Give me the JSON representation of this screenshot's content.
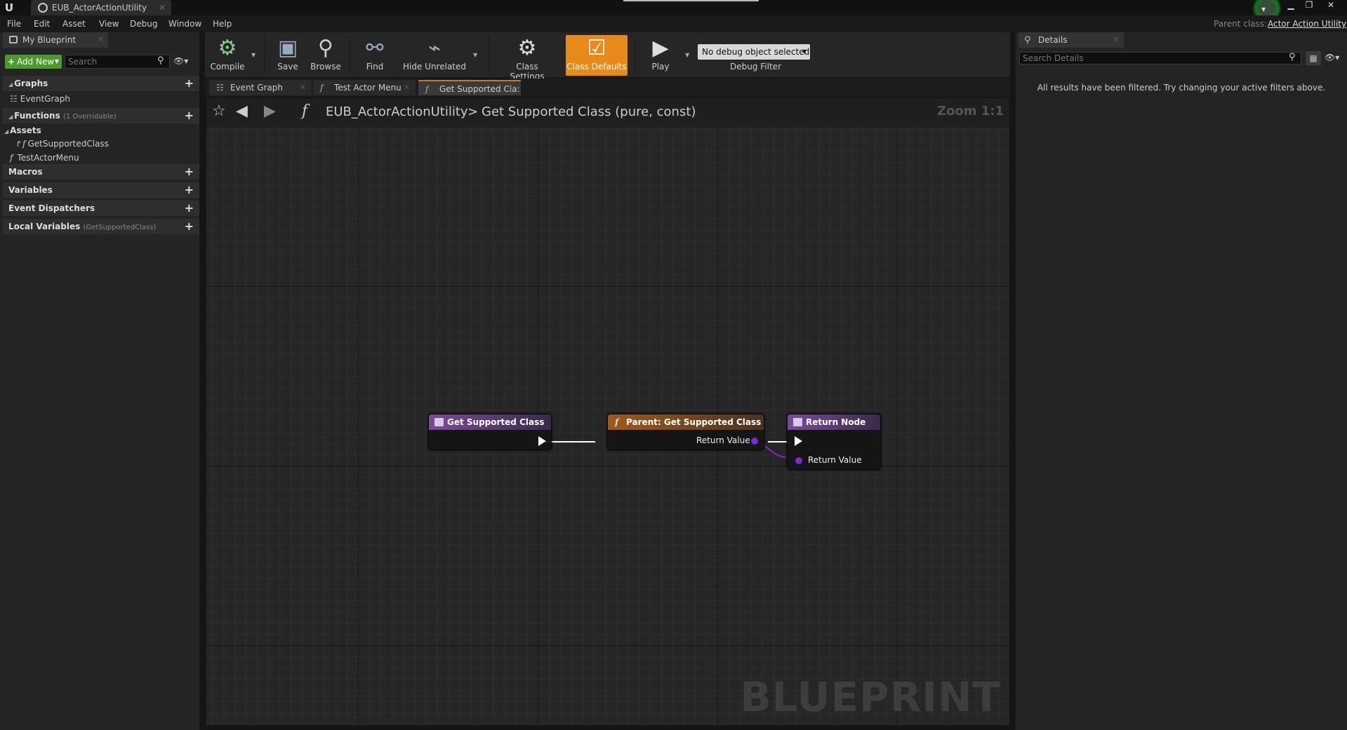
{
  "window": {
    "tab_title": "EUB_ActorActionUtility",
    "parent_class_label": "Parent class:",
    "parent_class_value": "Actor Action Utility"
  },
  "menu": [
    "File",
    "Edit",
    "Asset",
    "View",
    "Debug",
    "Window",
    "Help"
  ],
  "my_blueprint": {
    "tab_label": "My Blueprint",
    "add_new_label": "Add New",
    "search_placeholder": "Search",
    "categories": {
      "graphs": "Graphs",
      "functions": "Functions",
      "functions_sub": "(1 Overridable)",
      "macros": "Macros",
      "variables": "Variables",
      "event_dispatchers": "Event Dispatchers",
      "local_variables": "Local Variables",
      "local_variables_sub": "(GetSupportedClass)"
    },
    "graph_items": [
      "EventGraph"
    ],
    "assets_label": "Assets",
    "function_items": [
      "GetSupportedClass",
      "TestActorMenu"
    ]
  },
  "toolbar": {
    "compile": "Compile",
    "save": "Save",
    "browse": "Browse",
    "find": "Find",
    "hide_unrelated": "Hide Unrelated",
    "class_settings": "Class Settings",
    "class_defaults": "Class Defaults",
    "play": "Play",
    "debug_object": "No debug object selected",
    "debug_filter": "Debug Filter"
  },
  "graph_tabs": [
    "Event Graph",
    "Test Actor Menu",
    "Get Supported Cla:"
  ],
  "graph_header": {
    "blueprint_name": "EUB_ActorActionUtility",
    "separator": ">",
    "function_name": "Get Supported Class (pure, const)",
    "zoom": "Zoom 1:1"
  },
  "nodes": {
    "entry_title": "Get Supported Class",
    "parent_title": "Parent: Get Supported Class",
    "parent_output": "Return Value",
    "return_title": "Return Node",
    "return_input": "Return Value"
  },
  "watermark": "BLUEPRINT",
  "details": {
    "tab_label": "Details",
    "search_placeholder": "Search Details",
    "empty_message": "All results have been filtered. Try changing your active filters above."
  },
  "colors": {
    "accent_orange": "#e88a1a",
    "add_new_green": "#4a9a2c",
    "node_purple": "#7a4a9a",
    "node_orange": "#a05a1a",
    "pin_purple": "#7a2ad0"
  }
}
